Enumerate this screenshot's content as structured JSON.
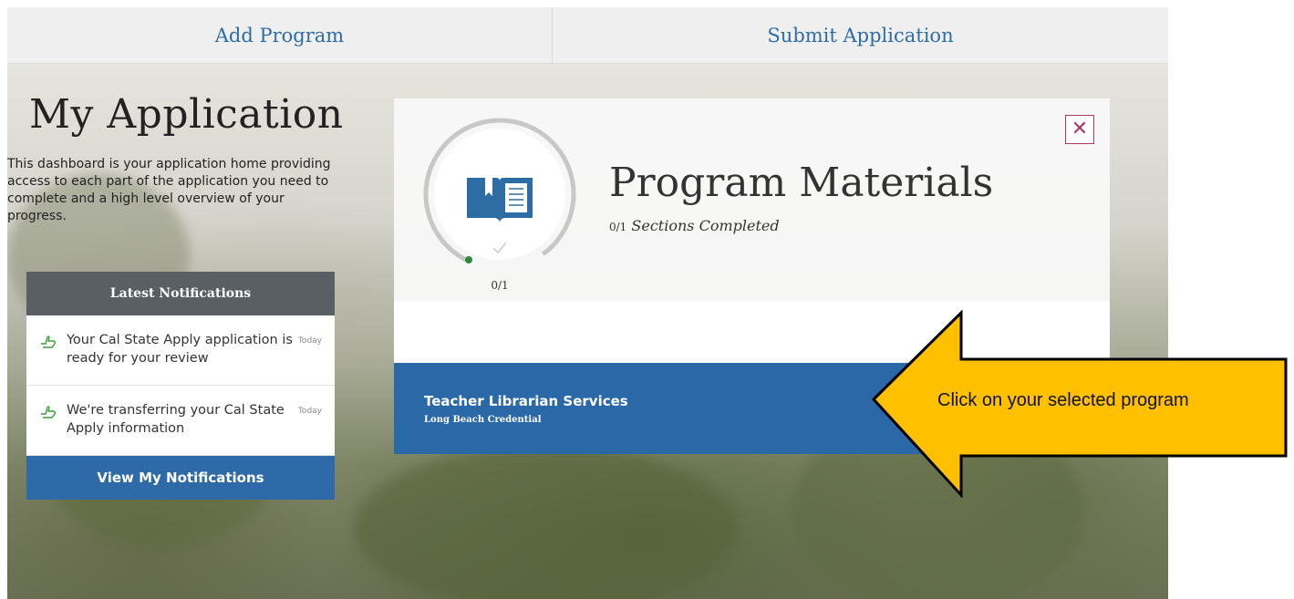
{
  "nav": {
    "add_program": "Add Program",
    "submit_application": "Submit Application"
  },
  "header": {
    "title": "My Application",
    "intro": "This dashboard is your application home providing access to each part of the application you need to complete and a high level overview of your progress."
  },
  "notifications": {
    "header": "Latest Notifications",
    "items": [
      {
        "text": "Your Cal State Apply application is ready for your review",
        "time": "Today"
      },
      {
        "text": "We're transferring your Cal State Apply information",
        "time": "Today"
      }
    ],
    "view_button": "View My Notifications"
  },
  "materials": {
    "title": "Program Materials",
    "completed_fraction": "0/1",
    "completed_label": "Sections Completed",
    "ring_label": "0/1",
    "progress": 0
  },
  "program": {
    "name": "Teacher Librarian Services",
    "campus": "Long Beach Credential"
  },
  "callout": {
    "text": "Click on your selected program"
  },
  "colors": {
    "accent": "#2b68a8",
    "callout": "#ffc000",
    "close": "#b03a5b",
    "notif_header": "#5a5f63"
  },
  "icons": {
    "close": "close-icon",
    "book": "book-icon",
    "check": "check-icon",
    "notification": "thumbs-up-icon"
  }
}
